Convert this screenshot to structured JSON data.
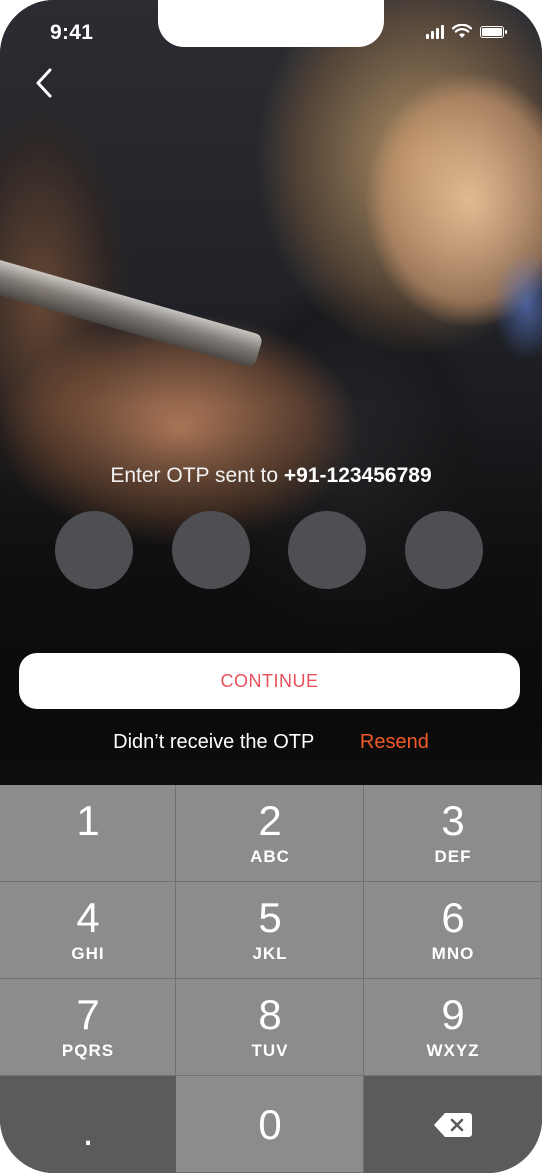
{
  "status_bar": {
    "time": "9:41",
    "signal_icon": "cellular-signal-icon",
    "wifi_icon": "wifi-icon",
    "battery_icon": "battery-icon"
  },
  "nav": {
    "back_icon": "chevron-left-icon"
  },
  "otp": {
    "prompt": "Enter OTP sent to",
    "phone": "+91-123456789",
    "digit_count": 4
  },
  "continue_label": "CONTINUE",
  "resend": {
    "message": "Didn’t receive the OTP",
    "link": "Resend"
  },
  "keypad": {
    "keys": [
      {
        "num": "1",
        "letters": ""
      },
      {
        "num": "2",
        "letters": "ABC"
      },
      {
        "num": "3",
        "letters": "DEF"
      },
      {
        "num": "4",
        "letters": "GHI"
      },
      {
        "num": "5",
        "letters": "JKL"
      },
      {
        "num": "6",
        "letters": "MNO"
      },
      {
        "num": "7",
        "letters": "PQRS"
      },
      {
        "num": "8",
        "letters": "TUV"
      },
      {
        "num": "9",
        "letters": "WXYZ"
      },
      {
        "num": ".",
        "letters": ""
      },
      {
        "num": "0",
        "letters": ""
      }
    ],
    "backspace_icon": "backspace-icon"
  },
  "colors": {
    "accent": "#f05a2a",
    "continue_text": "#e8505b",
    "otp_dot": "#4d4f53",
    "keypad_key": "#8c8c8c"
  }
}
